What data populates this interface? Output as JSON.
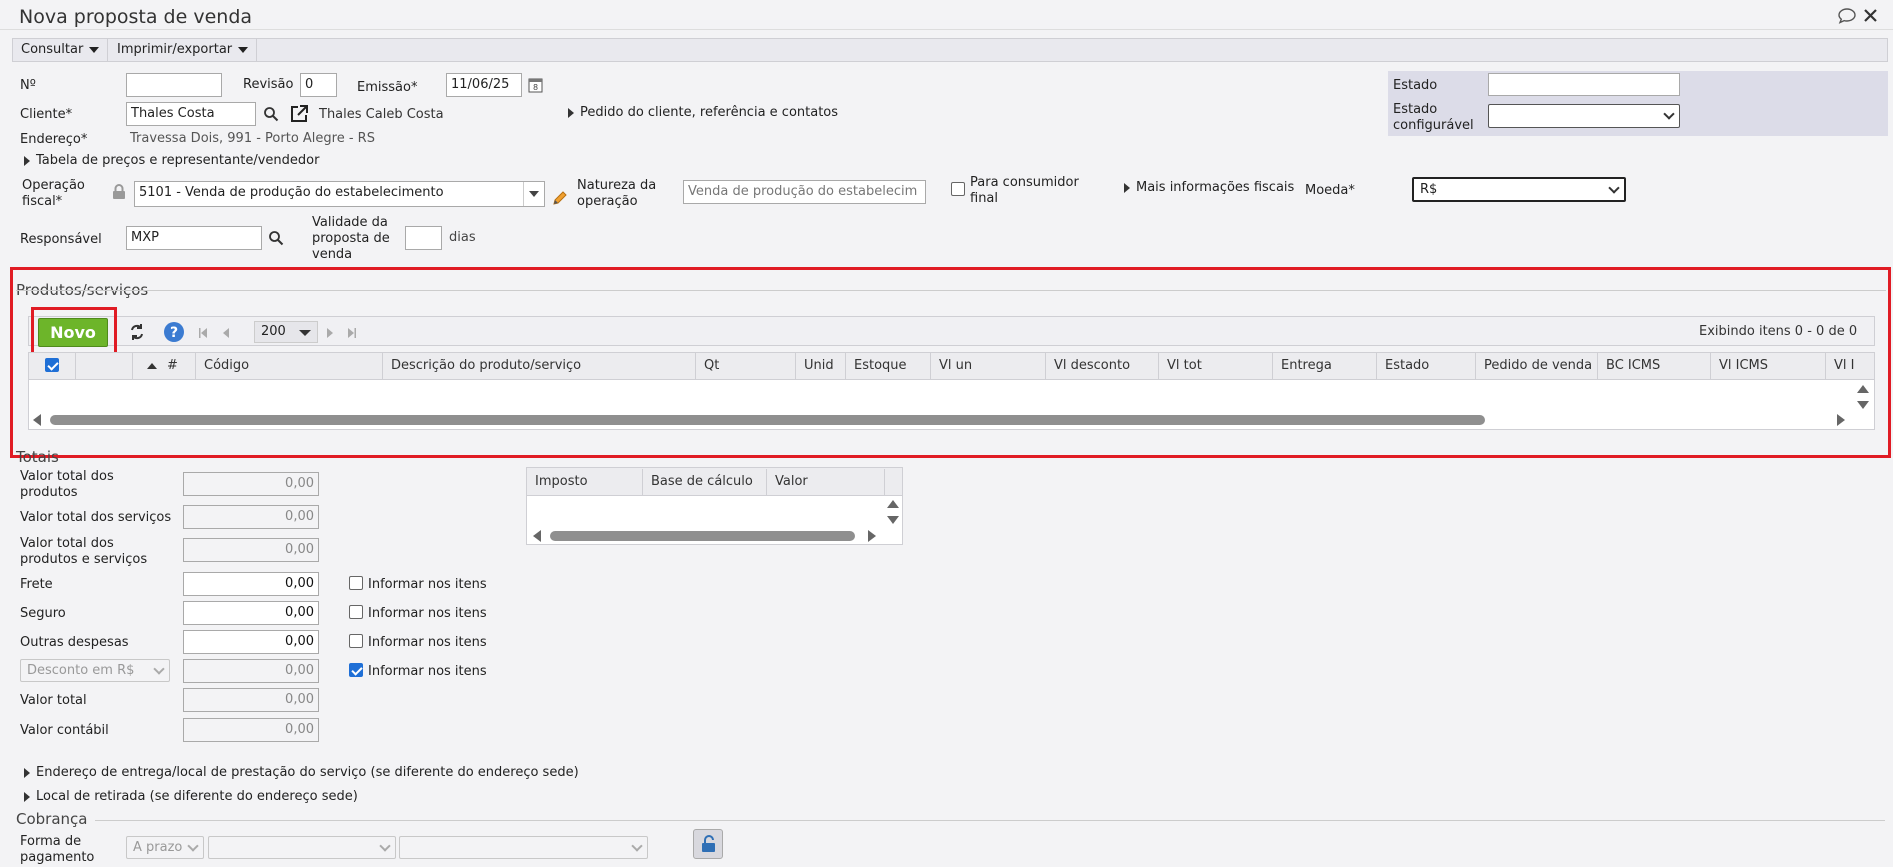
{
  "window": {
    "title": "Nova proposta de venda"
  },
  "menu": {
    "consultar": "Consultar",
    "imprimir": "Imprimir/exportar"
  },
  "header": {
    "numero_label": "Nº",
    "numero_value": "",
    "revisao_label": "Revisão",
    "revisao_value": "0",
    "emissao_label": "Emissão*",
    "emissao_value": "11/06/25",
    "cliente_label": "Cliente*",
    "cliente_value": "Thales Costa",
    "cliente_fullname": "Thales Caleb Costa",
    "pedido_link": "Pedido do cliente, referência e contatos",
    "endereco_label": "Endereço*",
    "endereco_value": "Travessa Dois, 991 - Porto Alegre - RS",
    "tabela_precos_link": "Tabela de preços e representante/vendedor",
    "estado_label": "Estado",
    "estado_value": "",
    "estado_config_label_1": "Estado",
    "estado_config_label_2": "configurável",
    "estado_config_value": "",
    "operacao_label_1": "Operação",
    "operacao_label_2": "fiscal*",
    "operacao_value": "5101 - Venda de produção do estabelecimento",
    "natureza_label_1": "Natureza da",
    "natureza_label_2": "operação",
    "natureza_value": "Venda de produção do estabelecim",
    "consumidor_label_1": "Para consumidor",
    "consumidor_label_2": "final",
    "mais_info_link": "Mais informações fiscais",
    "moeda_label": "Moeda*",
    "moeda_value": "R$",
    "responsavel_label": "Responsável",
    "responsavel_value": "MXP",
    "validade_label_1": "Validade da",
    "validade_label_2": "proposta de",
    "validade_label_3": "venda",
    "validade_value": "",
    "dias_label": "dias"
  },
  "produtos": {
    "title": "Produtos/serviços",
    "novo_button": "Novo",
    "page_size": "200",
    "exibindo": "Exibindo itens 0 - 0 de 0",
    "columns": [
      "#",
      "Código",
      "Descrição do produto/serviço",
      "Qt",
      "Unid",
      "Estoque",
      "Vl un",
      "Vl desconto",
      "Vl tot",
      "Entrega",
      "Estado",
      "Pedido de venda",
      "BC ICMS",
      "Vl ICMS",
      "Vl I"
    ]
  },
  "totais": {
    "title": "Totais",
    "rows": [
      {
        "label_1": "Valor total dos",
        "label_2": "produtos",
        "value": "0,00"
      },
      {
        "label_1": "Valor total dos serviços",
        "label_2": "",
        "value": "0,00"
      },
      {
        "label_1": "Valor total dos",
        "label_2": "produtos e serviços",
        "value": "0,00"
      },
      {
        "label_1": "Frete",
        "label_2": "",
        "value": "0,00"
      },
      {
        "label_1": "Seguro",
        "label_2": "",
        "value": "0,00"
      },
      {
        "label_1": "Outras despesas",
        "label_2": "",
        "value": "0,00"
      },
      {
        "label_1": "Desconto em R$",
        "label_2": "",
        "value": "0,00"
      },
      {
        "label_1": "Valor total",
        "label_2": "",
        "value": "0,00"
      },
      {
        "label_1": "Valor contábil",
        "label_2": "",
        "value": "0,00"
      }
    ],
    "informar_label": "Informar nos itens",
    "informar_checked": [
      false,
      false,
      false,
      true
    ],
    "impostos_columns": [
      "Imposto",
      "Base de cálculo",
      "Valor"
    ]
  },
  "links": {
    "endereco_entrega": "Endereço de entrega/local de prestação do serviço (se diferente do endereço sede)",
    "local_retirada": "Local de retirada (se diferente do endereço sede)"
  },
  "cobranca": {
    "title": "Cobrança",
    "forma_label_1": "Forma de",
    "forma_label_2": "pagamento",
    "forma_value": "A prazo"
  },
  "colors": {
    "accent_green": "#6db52a",
    "highlight_red": "#e01b24",
    "estado_bg": "#dcdce8"
  }
}
